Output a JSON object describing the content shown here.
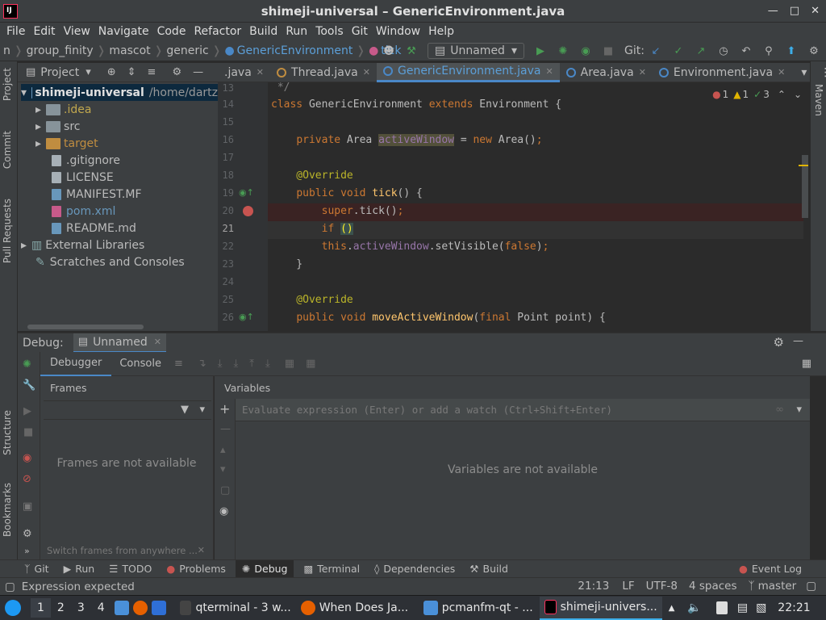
{
  "window": {
    "title": "shimeji-universal – GenericEnvironment.java",
    "app_icon_label": "IJ"
  },
  "menu": [
    "File",
    "Edit",
    "View",
    "Navigate",
    "Code",
    "Refactor",
    "Build",
    "Run",
    "Tools",
    "Git",
    "Window",
    "Help"
  ],
  "breadcrumbs": [
    "n",
    "group_finity",
    "mascot",
    "generic",
    "GenericEnvironment",
    "tick"
  ],
  "run_config": "Unnamed",
  "git_label": "Git:",
  "project_panel": {
    "title": "Project",
    "root": "shimeji-universal",
    "root_path": "/home/dartz",
    "items": [
      {
        "label": ".idea",
        "type": "folder"
      },
      {
        "label": "src",
        "type": "folder"
      },
      {
        "label": "target",
        "type": "folder-excluded"
      },
      {
        "label": ".gitignore",
        "type": "file"
      },
      {
        "label": "LICENSE",
        "type": "file"
      },
      {
        "label": "MANIFEST.MF",
        "type": "file"
      },
      {
        "label": "pom.xml",
        "type": "file"
      },
      {
        "label": "README.md",
        "type": "file"
      },
      {
        "label": "External Libraries",
        "type": "lib"
      },
      {
        "label": "Scratches and Consoles",
        "type": "scratch"
      }
    ]
  },
  "editor_tabs": [
    {
      "label": ".java",
      "active": false
    },
    {
      "label": "Thread.java",
      "active": false
    },
    {
      "label": "GenericEnvironment.java",
      "active": true
    },
    {
      "label": "Area.java",
      "active": false
    },
    {
      "label": "Environment.java",
      "active": false
    }
  ],
  "inspections": {
    "errors": "1",
    "warnings": "1",
    "ok": "3"
  },
  "code_lines": [
    {
      "n": "13",
      "text": " */"
    },
    {
      "n": "14",
      "text": "class GenericEnvironment extends Environment {"
    },
    {
      "n": "15",
      "text": ""
    },
    {
      "n": "16",
      "text": "    private Area activeWindow = new Area();"
    },
    {
      "n": "17",
      "text": ""
    },
    {
      "n": "18",
      "text": "    @Override"
    },
    {
      "n": "19",
      "text": "    public void tick() {"
    },
    {
      "n": "20",
      "text": "        super.tick();"
    },
    {
      "n": "21",
      "text": "        if ()"
    },
    {
      "n": "22",
      "text": "        this.activeWindow.setVisible(false);"
    },
    {
      "n": "23",
      "text": "    }"
    },
    {
      "n": "24",
      "text": ""
    },
    {
      "n": "25",
      "text": "    @Override"
    },
    {
      "n": "26",
      "text": "    public void moveActiveWindow(final Point point) {"
    }
  ],
  "debug": {
    "title": "Debug:",
    "config": "Unnamed",
    "tabs": [
      "Debugger",
      "Console"
    ],
    "frames_title": "Frames",
    "frames_empty": "Frames are not available",
    "frames_hint": "Switch frames from anywhere ...",
    "variables_title": "Variables",
    "eval_placeholder": "Evaluate expression (Enter) or add a watch (Ctrl+Shift+Enter)",
    "variables_empty": "Variables are not available"
  },
  "left_tool_tabs": [
    "Project",
    "Commit",
    "Pull Requests",
    "Structure",
    "Bookmarks"
  ],
  "right_tool_tabs": [
    "Maven"
  ],
  "tool_windows": [
    "Git",
    "Run",
    "TODO",
    "Problems",
    "Debug",
    "Terminal",
    "Dependencies",
    "Build"
  ],
  "event_log": "Event Log",
  "status": {
    "message": "Expression expected",
    "position": "21:13",
    "line_sep": "LF",
    "encoding": "UTF-8",
    "indent": "4 spaces",
    "branch": "master"
  },
  "taskbar": {
    "workspaces": [
      "1",
      "2",
      "3",
      "4"
    ],
    "tasks": [
      {
        "label": "qterminal - 3 w...",
        "active": false
      },
      {
        "label": "When Does Ja...",
        "active": false
      },
      {
        "label": "pcmanfm-qt - ...",
        "active": false
      },
      {
        "label": "shimeji-univers...",
        "active": true
      }
    ],
    "clock": "22:21"
  },
  "colors": {
    "accent": "#4a88c7",
    "breakpoint": "#c75450",
    "run_green": "#499c54"
  }
}
